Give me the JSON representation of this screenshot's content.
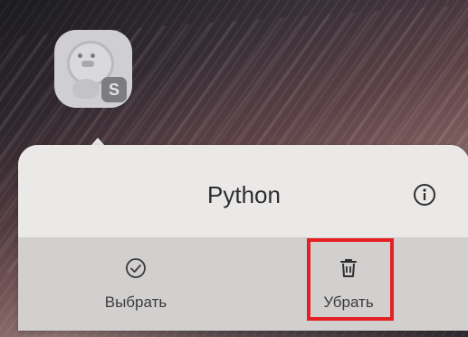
{
  "app": {
    "icon_name": "python-duck-app-icon",
    "badge_letter": "S",
    "name": "Python"
  },
  "popup": {
    "title": "Python",
    "info_icon": "info-icon",
    "actions": [
      {
        "label": "Выбрать",
        "icon": "check-circle-icon"
      },
      {
        "label": "Убрать",
        "icon": "trash-icon"
      }
    ]
  },
  "colors": {
    "highlight": "#e32125",
    "popup_header": "#ebe8e8",
    "popup_actions": "#d2cfcf"
  }
}
